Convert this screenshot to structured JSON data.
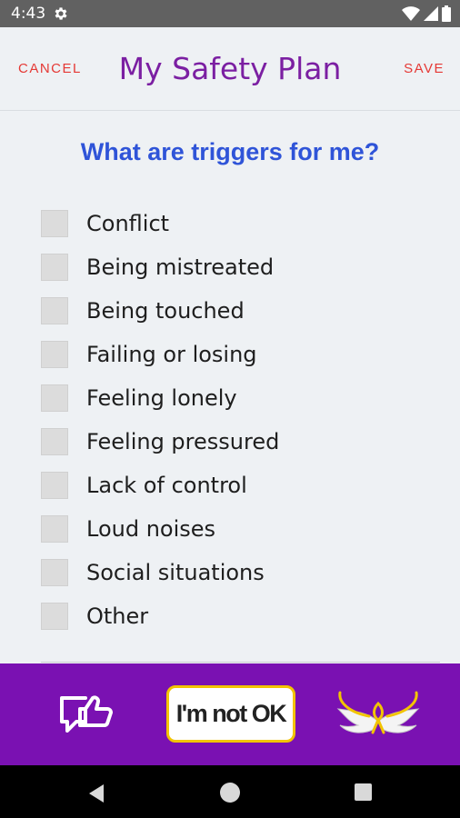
{
  "status_bar": {
    "time": "4:43",
    "icons": [
      "gear-icon",
      "wifi-icon",
      "signal-icon",
      "battery-icon"
    ]
  },
  "header": {
    "title": "My Safety Plan",
    "cancel_label": "CANCEL",
    "save_label": "SAVE"
  },
  "question": "What are triggers for me?",
  "options": [
    {
      "label": "Conflict",
      "checked": false
    },
    {
      "label": "Being mistreated",
      "checked": false
    },
    {
      "label": "Being touched",
      "checked": false
    },
    {
      "label": "Failing or losing",
      "checked": false
    },
    {
      "label": "Feeling lonely",
      "checked": false
    },
    {
      "label": "Feeling pressured",
      "checked": false
    },
    {
      "label": "Lack of control",
      "checked": false
    },
    {
      "label": "Loud noises",
      "checked": false
    },
    {
      "label": "Social situations",
      "checked": false
    },
    {
      "label": "Other",
      "checked": false
    }
  ],
  "bottom_bar": {
    "not_ok_label": "I'm not OK",
    "left_icon": "thumbs-up-chat-icon",
    "right_icon": "wings-logo"
  },
  "nav_bar": {
    "icons": [
      "back-icon",
      "home-icon",
      "recent-apps-icon"
    ]
  },
  "colors": {
    "accent_purple": "#7b1fa2",
    "bottom_bar": "#7a11b2",
    "question_blue": "#2f54d8",
    "action_red": "#e53935",
    "button_border_yellow": "#f2c400"
  }
}
